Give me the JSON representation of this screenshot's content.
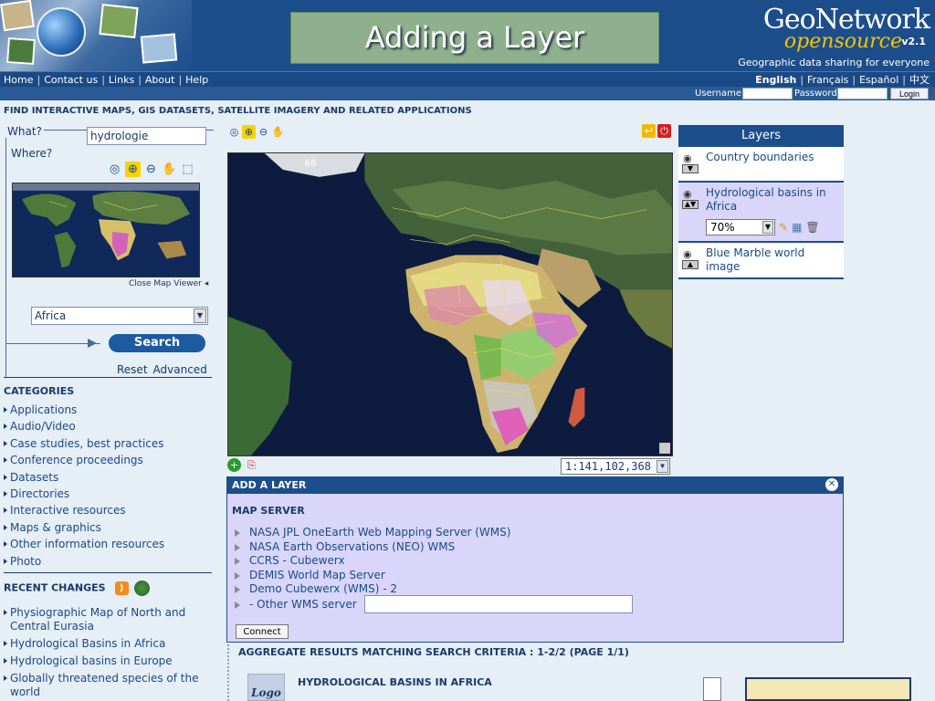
{
  "slide": {
    "title": "Adding a Layer"
  },
  "brand": {
    "name": "GeoNetwork",
    "sub": "opensource",
    "version": "v2.1",
    "tagline": "Geographic data sharing for everyone"
  },
  "nav": {
    "links": [
      "Home",
      "Contact us",
      "Links",
      "About",
      "Help"
    ],
    "languages": [
      "English",
      "Français",
      "Español",
      "中文"
    ],
    "active_language": "English"
  },
  "login": {
    "username_label": "Username",
    "password_label": "Password",
    "login_button": "Login"
  },
  "find_title": "FIND INTERACTIVE MAPS, GIS DATASETS, SATELLITE IMAGERY AND RELATED APPLICATIONS",
  "search": {
    "what_label": "What?",
    "what_value": "hydrologie",
    "where_label": "Where?",
    "close_map_viewer": "Close Map Viewer",
    "region_value": "Africa",
    "search_button": "Search",
    "reset": "Reset",
    "advanced": "Advanced"
  },
  "categories": {
    "title": "CATEGORIES",
    "items": [
      "Applications",
      "Audio/Video",
      "Case studies, best practices",
      "Conference proceedings",
      "Datasets",
      "Directories",
      "Interactive resources",
      "Maps & graphics",
      "Other information resources",
      "Photo"
    ]
  },
  "recent_changes": {
    "title": "RECENT CHANGES",
    "items": [
      "Physiographic Map of North and Central Eurasia",
      "Hydrological Basins in Africa",
      "Hydrological basins in Europe",
      "Globally threatened species of the world"
    ]
  },
  "map": {
    "corner_label": "68",
    "scale_value": "1:141,102,368"
  },
  "layers": {
    "title": "Layers",
    "items": [
      {
        "name": "Country boundaries"
      },
      {
        "name": "Hydrological basins in Africa",
        "opacity": "70%"
      },
      {
        "name": "Blue Marble world image"
      }
    ]
  },
  "add_layer": {
    "title": "ADD A LAYER",
    "map_server_title": "MAP SERVER",
    "servers": [
      "NASA JPL OneEarth Web Mapping Server (WMS)",
      "NASA Earth Observations (NEO) WMS",
      "CCRS - Cubewerx",
      "DEMIS World Map Server",
      "Demo Cubewerx (WMS) - 2"
    ],
    "other_label": "- Other WMS server",
    "other_value": "",
    "connect_button": "Connect"
  },
  "results": {
    "title": "AGGREGATE RESULTS MATCHING SEARCH CRITERIA :   1-2/2   (PAGE 1/1)",
    "first_title": "HYDROLOGICAL BASINS IN AFRICA",
    "logo_text": "Logo"
  },
  "colors": {
    "header_blue": "#1d4e8c",
    "panel_lilac": "#d9d6fa",
    "page_bg": "#e6eef6",
    "accent_yellow": "#f5d400"
  }
}
